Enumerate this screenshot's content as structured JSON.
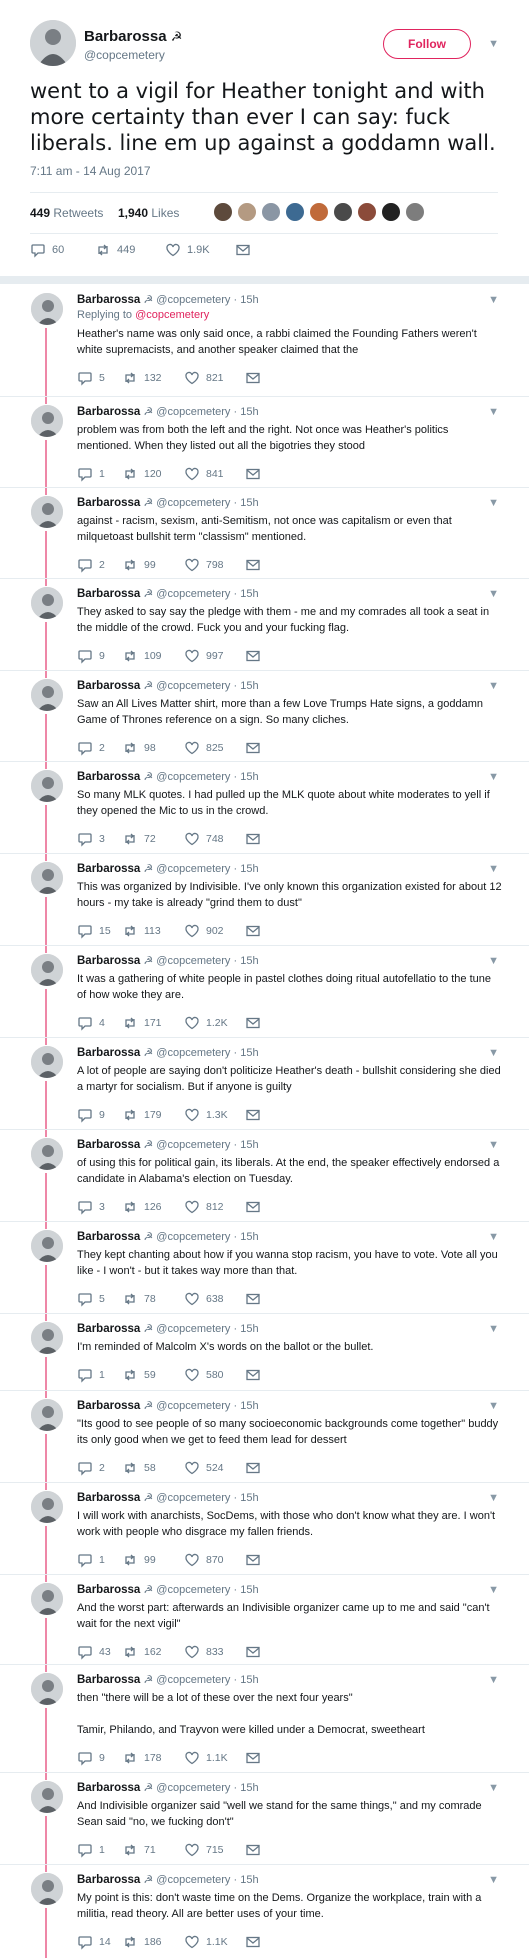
{
  "main": {
    "name": "Barbarossa",
    "handle": "@copcemetery",
    "follow_label": "Follow",
    "text": "went to a vigil for Heather tonight and with more certainty than ever I can say: fuck liberals. line em up against a goddamn wall.",
    "timestamp": "7:11 am - 14 Aug 2017",
    "retweets_count": "449",
    "retweets_label": "Retweets",
    "likes_count": "1,940",
    "likes_label": "Likes",
    "actions": {
      "replies": "60",
      "retweets": "449",
      "likes": "1.9K"
    }
  },
  "accent_color": "#e0245e",
  "replies": [
    {
      "name": "Barbarossa",
      "handle": "@copcemetery · 15h",
      "replying_prefix": "Replying to",
      "replying_to": "@copcemetery",
      "text": "Heather's name was only said once, a rabbi claimed the Founding Fathers weren't white supremacists, and another speaker claimed that the",
      "replies": "5",
      "retweets": "132",
      "likes": "821"
    },
    {
      "name": "Barbarossa",
      "handle": "@copcemetery · 15h",
      "text": "problem was from both the left and the right. Not once was Heather's politics mentioned. When they listed out all the bigotries they stood",
      "replies": "1",
      "retweets": "120",
      "likes": "841"
    },
    {
      "name": "Barbarossa",
      "handle": "@copcemetery · 15h",
      "text": "against - racism, sexism, anti-Semitism, not once was capitalism or even that milquetoast bullshit term \"classism\" mentioned.",
      "replies": "2",
      "retweets": "99",
      "likes": "798"
    },
    {
      "name": "Barbarossa",
      "handle": "@copcemetery · 15h",
      "text": "They asked to say say the pledge with them - me and my comrades all took a seat in the middle of the crowd. Fuck you and your fucking flag.",
      "replies": "9",
      "retweets": "109",
      "likes": "997"
    },
    {
      "name": "Barbarossa",
      "handle": "@copcemetery · 15h",
      "text": "Saw an All Lives Matter shirt, more than a few Love Trumps Hate signs, a goddamn Game of Thrones reference on a sign. So many cliches.",
      "replies": "2",
      "retweets": "98",
      "likes": "825"
    },
    {
      "name": "Barbarossa",
      "handle": "@copcemetery · 15h",
      "text": "So many MLK quotes. I had pulled up the MLK quote about white moderates to yell if they opened the Mic to us in the crowd.",
      "replies": "3",
      "retweets": "72",
      "likes": "748"
    },
    {
      "name": "Barbarossa",
      "handle": "@copcemetery · 15h",
      "text": "This was organized by Indivisible. I've only known this organization existed for about 12 hours - my take is already \"grind them to dust\"",
      "replies": "15",
      "retweets": "113",
      "likes": "902"
    },
    {
      "name": "Barbarossa",
      "handle": "@copcemetery · 15h",
      "text": "It was a gathering of white people in pastel clothes doing ritual autofellatio to the tune of how woke they are.",
      "replies": "4",
      "retweets": "171",
      "likes": "1.2K"
    },
    {
      "name": "Barbarossa",
      "handle": "@copcemetery · 15h",
      "text": "A lot of people are saying don't politicize Heather's death - bullshit considering she died a martyr for socialism. But if anyone is guilty",
      "replies": "9",
      "retweets": "179",
      "likes": "1.3K"
    },
    {
      "name": "Barbarossa",
      "handle": "@copcemetery · 15h",
      "text": "of using this for political gain, its liberals. At the end, the speaker effectively endorsed a candidate in Alabama's election on Tuesday.",
      "replies": "3",
      "retweets": "126",
      "likes": "812"
    },
    {
      "name": "Barbarossa",
      "handle": "@copcemetery · 15h",
      "text": "They kept chanting about how if you wanna stop racism, you have to vote. Vote all you like - I won't - but it takes way more than that.",
      "replies": "5",
      "retweets": "78",
      "likes": "638"
    },
    {
      "name": "Barbarossa",
      "handle": "@copcemetery · 15h",
      "text": "I'm reminded of Malcolm X's words on the ballot or the bullet.",
      "replies": "1",
      "retweets": "59",
      "likes": "580"
    },
    {
      "name": "Barbarossa",
      "handle": "@copcemetery · 15h",
      "text": "\"Its good to see people of so many socioeconomic backgrounds come together\" buddy its only good when we get to feed them lead for dessert",
      "replies": "2",
      "retweets": "58",
      "likes": "524"
    },
    {
      "name": "Barbarossa",
      "handle": "@copcemetery · 15h",
      "text": "I will work with anarchists, SocDems, with those who don't know what they are. I won't work with people who disgrace my fallen friends.",
      "replies": "1",
      "retweets": "99",
      "likes": "870"
    },
    {
      "name": "Barbarossa",
      "handle": "@copcemetery · 15h",
      "text": "And the worst part: afterwards an Indivisible organizer came up to me and said \"can't wait for the next vigil\"",
      "replies": "43",
      "retweets": "162",
      "likes": "833"
    },
    {
      "name": "Barbarossa",
      "handle": "@copcemetery · 15h",
      "text": "then \"there will be a lot of these over the next four years\"\n\nTamir, Philando, and Trayvon were killed under a Democrat, sweetheart",
      "replies": "9",
      "retweets": "178",
      "likes": "1.1K"
    },
    {
      "name": "Barbarossa",
      "handle": "@copcemetery · 15h",
      "text": "And Indivisible organizer said \"well we stand for the same things,\" and my comrade Sean said \"no, we fucking don't\"",
      "replies": "1",
      "retweets": "71",
      "likes": "715"
    },
    {
      "name": "Barbarossa",
      "handle": "@copcemetery · 15h",
      "text": "My point is this: don't waste time on the Dems. Organize the workplace, train with a militia, read theory. All are better uses of your time.",
      "replies": "14",
      "retweets": "186",
      "likes": "1.1K"
    }
  ]
}
